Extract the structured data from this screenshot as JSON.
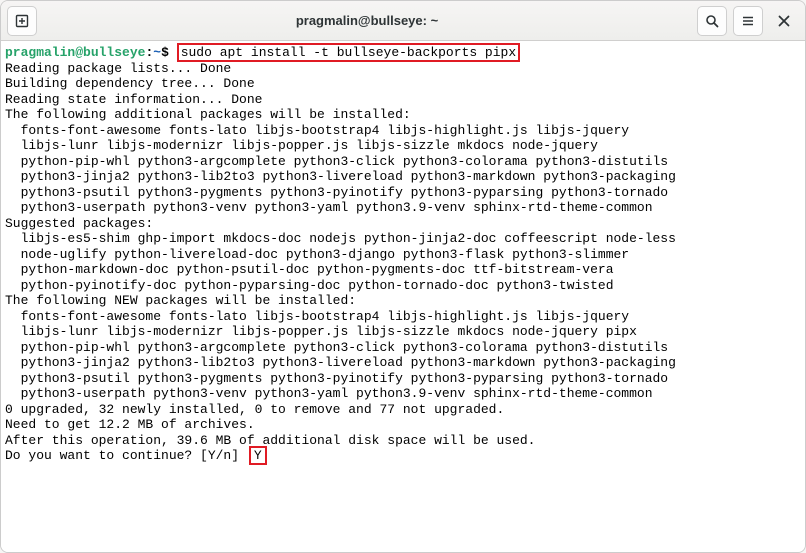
{
  "titlebar": {
    "title": "pragmalin@bullseye: ~"
  },
  "prompt": {
    "user": "pragmalin@bullseye",
    "colon": ":",
    "path": "~",
    "dollar": "$"
  },
  "command": "sudo apt install -t bullseye-backports pipx",
  "output": {
    "l1": "Reading package lists... Done",
    "l2": "Building dependency tree... Done",
    "l3": "Reading state information... Done",
    "l4": "The following additional packages will be installed:",
    "l5": "  fonts-font-awesome fonts-lato libjs-bootstrap4 libjs-highlight.js libjs-jquery",
    "l6": "  libjs-lunr libjs-modernizr libjs-popper.js libjs-sizzle mkdocs node-jquery",
    "l7": "  python-pip-whl python3-argcomplete python3-click python3-colorama python3-distutils",
    "l8": "  python3-jinja2 python3-lib2to3 python3-livereload python3-markdown python3-packaging",
    "l9": "  python3-psutil python3-pygments python3-pyinotify python3-pyparsing python3-tornado",
    "l10": "  python3-userpath python3-venv python3-yaml python3.9-venv sphinx-rtd-theme-common",
    "l11": "Suggested packages:",
    "l12": "  libjs-es5-shim ghp-import mkdocs-doc nodejs python-jinja2-doc coffeescript node-less",
    "l13": "  node-uglify python-livereload-doc python3-django python3-flask python3-slimmer",
    "l14": "  python-markdown-doc python-psutil-doc python-pygments-doc ttf-bitstream-vera",
    "l15": "  python-pyinotify-doc python-pyparsing-doc python-tornado-doc python3-twisted",
    "l16": "The following NEW packages will be installed:",
    "l17": "  fonts-font-awesome fonts-lato libjs-bootstrap4 libjs-highlight.js libjs-jquery",
    "l18": "  libjs-lunr libjs-modernizr libjs-popper.js libjs-sizzle mkdocs node-jquery pipx",
    "l19": "  python-pip-whl python3-argcomplete python3-click python3-colorama python3-distutils",
    "l20": "  python3-jinja2 python3-lib2to3 python3-livereload python3-markdown python3-packaging",
    "l21": "  python3-psutil python3-pygments python3-pyinotify python3-pyparsing python3-tornado",
    "l22": "  python3-userpath python3-venv python3-yaml python3.9-venv sphinx-rtd-theme-common",
    "l23": "0 upgraded, 32 newly installed, 0 to remove and 77 not upgraded.",
    "l24": "Need to get 12.2 MB of archives.",
    "l25": "After this operation, 39.6 MB of additional disk space will be used.",
    "l26": "Do you want to continue? [Y/n] "
  },
  "answer": "Y"
}
